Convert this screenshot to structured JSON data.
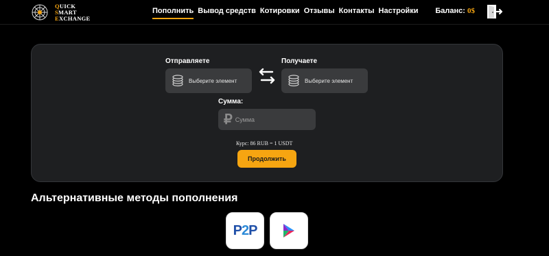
{
  "header": {
    "logo": {
      "line1": "QUICK",
      "line2": "SMART",
      "line3": "EXCHANGE"
    },
    "nav": [
      {
        "label": "Пополнить",
        "active": true
      },
      {
        "label": "Вывод средств",
        "active": false
      },
      {
        "label": "Котировки",
        "active": false
      },
      {
        "label": "Отзывы",
        "active": false
      },
      {
        "label": "Контакты",
        "active": false
      },
      {
        "label": "Настройки",
        "active": false
      }
    ],
    "balance_label": "Баланс:",
    "balance_value": "0$"
  },
  "exchange": {
    "send_label": "Отправляете",
    "send_placeholder": "Выберите элемент",
    "receive_label": "Получаете",
    "receive_placeholder": "Выберите элемент",
    "amount_label": "Сумма:",
    "amount_placeholder": "Сумма",
    "rate_text": "Курс: 86 RUB = 1 USDT",
    "continue_label": "Продолжить"
  },
  "alternative": {
    "title": "Альтернативные методы пополнения",
    "methods": [
      {
        "icon": "p2p-icon"
      },
      {
        "icon": "play-payment-icon"
      }
    ]
  },
  "colors": {
    "accent": "#f6a511",
    "card": "#1e1f21",
    "field": "#3a3b3d",
    "background": "#000000"
  }
}
